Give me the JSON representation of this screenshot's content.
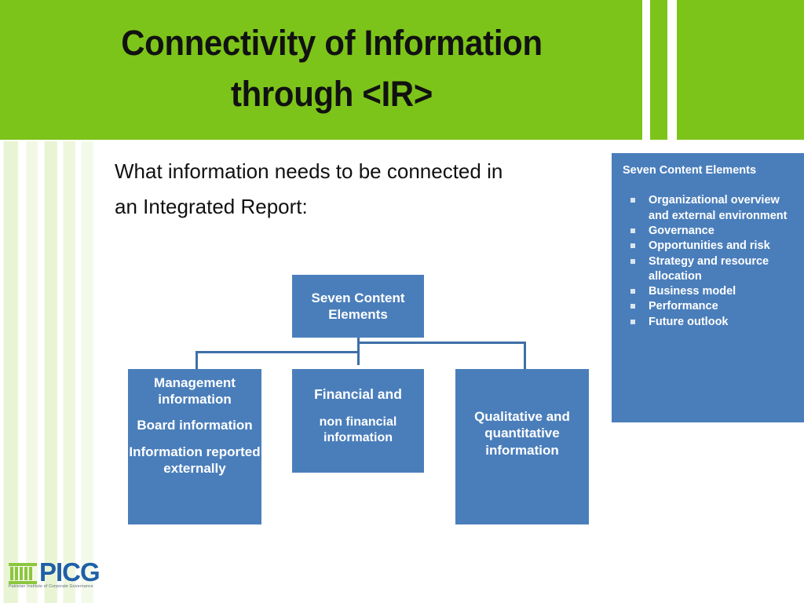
{
  "header": {
    "title": "Connectivity of Information\nthrough <IR>",
    "green": "#7DC41A"
  },
  "body": {
    "prompt": "What information needs to be connected in\nan Integrated Report:"
  },
  "side_panel": {
    "title": "Seven Content Elements",
    "accent": "#4A7EBB",
    "items": [
      "Organizational overview and external environment",
      "Governance",
      "Opportunities and risk",
      "Strategy and resource allocation",
      "Business model",
      "Performance",
      "Future outlook"
    ]
  },
  "diagram": {
    "node_color": "#4A7EBB",
    "line_color": "#3E6FA8",
    "root": "Seven Content\nElements",
    "left": {
      "line1": "Management information",
      "line2": "Board information",
      "line3": "Information reported externally"
    },
    "middle": {
      "lead": "Financial and",
      "rest": "non financial information"
    },
    "right": "Qualitative and quantitative information"
  },
  "logo": {
    "wordmark": "PICG",
    "tagline": "Pakistan Institute of Corporate Governance",
    "mark_color": "#8CC63E",
    "word_color": "#1F5FA8"
  }
}
